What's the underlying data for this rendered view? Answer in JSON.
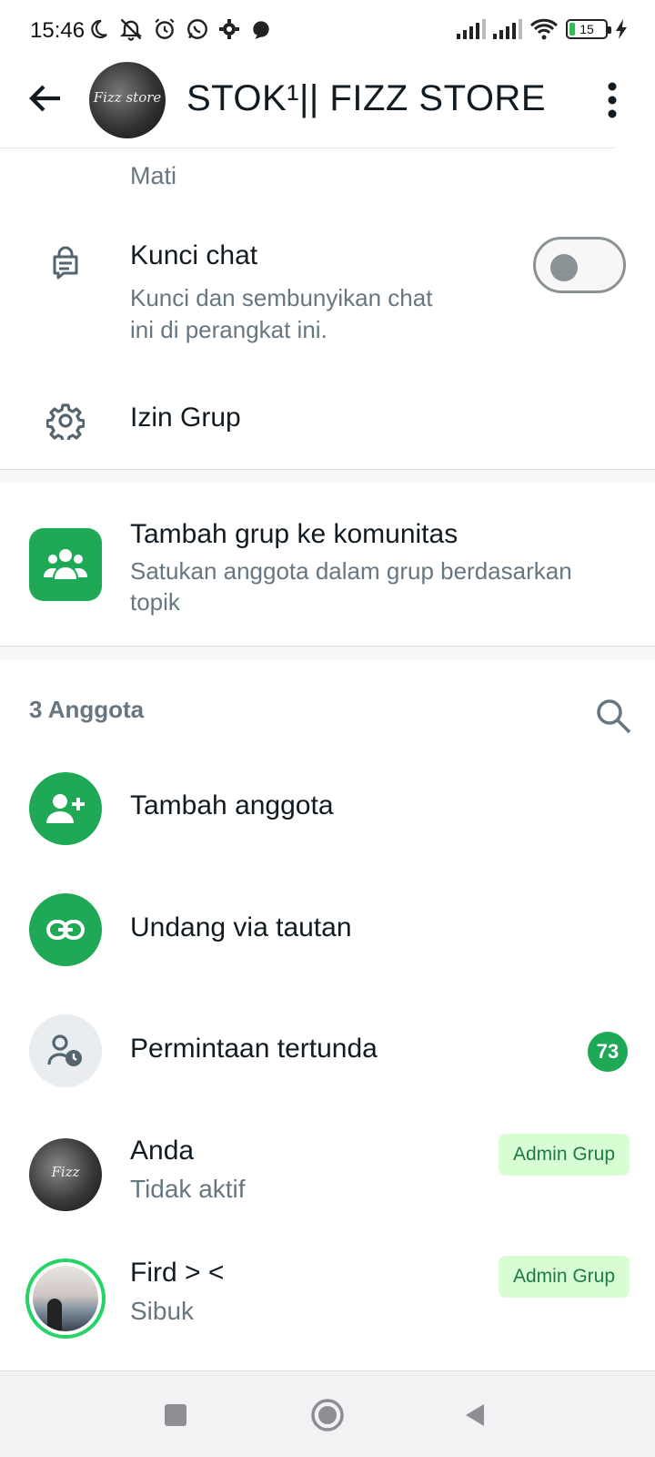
{
  "status_bar": {
    "time": "15:46",
    "battery_level": "15",
    "left_icons": [
      "moon-icon",
      "muted-bell-icon",
      "alarm-icon",
      "whatsapp-icon",
      "gear-icon",
      "app-icon"
    ],
    "right_icons": [
      "signal-icon",
      "signal-icon",
      "wifi-icon",
      "battery-icon",
      "charging-icon"
    ]
  },
  "header": {
    "title": "STOK¹|| FIZZ STORE",
    "avatar_text": "Fizz store",
    "back_icon": "arrow-left-icon",
    "menu_icon": "more-vertical-icon"
  },
  "settings": {
    "partial_value": "Mati",
    "lock_chat": {
      "title": "Kunci chat",
      "subtitle_line1": "Kunci dan sembunyikan chat",
      "subtitle_line2": "ini di perangkat ini.",
      "enabled": false
    },
    "group_permissions": {
      "title": "Izin Grup"
    }
  },
  "community": {
    "title": "Tambah grup ke komunitas",
    "subtitle_line1": "Satukan anggota dalam grup berdasarkan",
    "subtitle_line2": "topik"
  },
  "members": {
    "count_label": "3 Anggota",
    "actions": [
      {
        "label": "Tambah anggota",
        "icon": "add-person-icon"
      },
      {
        "label": "Undang via tautan",
        "icon": "link-icon"
      },
      {
        "label": "Permintaan tertunda",
        "icon": "pending-person-icon",
        "badge": "73"
      }
    ],
    "list": [
      {
        "name": "Anda",
        "status": "Tidak aktif",
        "role": "Admin Grup",
        "avatar_text": "Fizz"
      },
      {
        "name": "Fird > <",
        "status": "Sibuk",
        "role": "Admin Grup"
      }
    ]
  },
  "colors": {
    "accent": "#1fa855",
    "admin_tag_bg": "#d9fdd3",
    "admin_tag_text": "#1d7a4a",
    "secondary_text": "#667781"
  }
}
